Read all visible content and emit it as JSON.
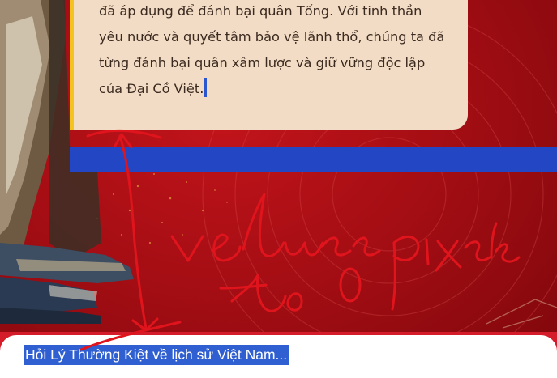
{
  "answer": {
    "lines": [
      "đã áp dụng để đánh bại quân Tống. Với tinh thần",
      "yêu nước và quyết tâm bảo vệ lãnh thổ, chúng ta đã",
      "từng đánh bại quân xâm lược và giữ vững độc lập",
      "của Đại Cồ Việt."
    ]
  },
  "chat_input": {
    "placeholder": "Hỏi Lý Thường Kiệt về lịch sử Việt Nam..."
  },
  "annotation": {
    "handwritten_text": "reduce to 0 pixels",
    "color": "#e0141c"
  },
  "colors": {
    "background": "#a90d12",
    "card": "#f3dcc5",
    "card_accent": "#f4c31f",
    "blue_bar": "#2347c4",
    "input_accent": "#d51c2a"
  }
}
